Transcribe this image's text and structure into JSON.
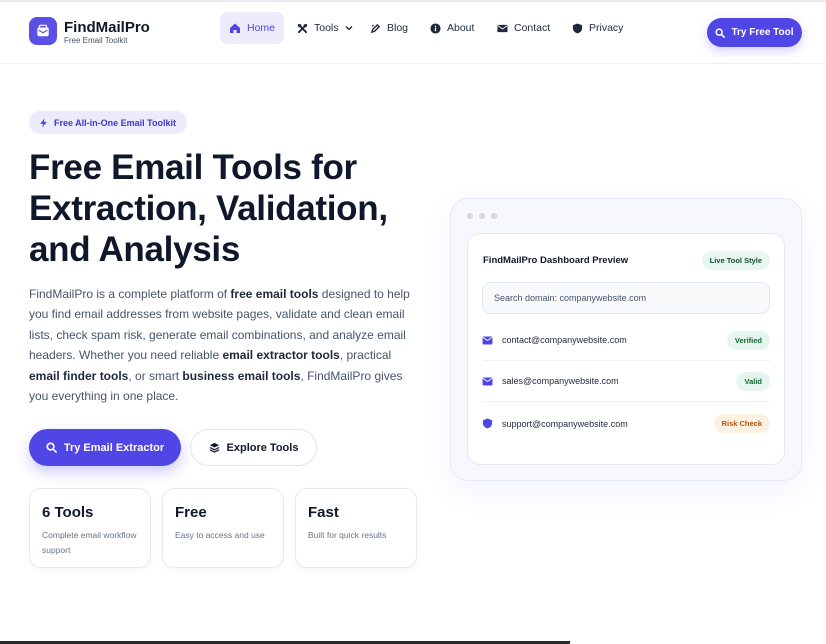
{
  "header": {
    "brand": "FindMailPro",
    "tagline": "Free Email Toolkit",
    "nav": [
      {
        "label": "Home",
        "icon": "home-icon"
      },
      {
        "label": "Tools",
        "icon": "tools-icon"
      },
      {
        "label": "Blog",
        "icon": "blog-icon"
      },
      {
        "label": "About",
        "icon": "info-icon"
      },
      {
        "label": "Contact",
        "icon": "envelope-icon"
      },
      {
        "label": "Privacy",
        "icon": "shield-icon"
      }
    ],
    "cta": "Try Free Tool"
  },
  "hero": {
    "badge": "Free All-in-One Email Toolkit",
    "title_lines": [
      "Free Email Tools for",
      "Extraction, Validation,",
      "and Analysis"
    ],
    "description": {
      "p1": "FindMailPro is a complete platform of ",
      "b1": "free email tools",
      "p2": " designed to help you find email addresses from website pages, validate and clean email lists, check spam risk, generate email combinations, and analyze email headers. Whether you need reliable ",
      "b2": "email extractor tools",
      "p3": ", practical ",
      "b3": "email finder tools",
      "p4": ", or smart ",
      "b4": "business email tools",
      "p5": ", FindMailPro gives you everything in one place."
    },
    "primary_button": "Try Email Extractor",
    "secondary_button": "Explore Tools"
  },
  "stats": [
    {
      "title": "6 Tools",
      "subtitle": "Complete email workflow support"
    },
    {
      "title": "Free",
      "subtitle": "Easy to access and use"
    },
    {
      "title": "Fast",
      "subtitle": "Built for quick results"
    }
  ],
  "preview": {
    "title": "FindMailPro Dashboard Preview",
    "tag": "Live Tool Style",
    "search_placeholder": "Search domain: companywebsite.com",
    "rows": [
      {
        "email": "contact@companywebsite.com",
        "status": "Verified",
        "icon": "envelope-icon"
      },
      {
        "email": "sales@companywebsite.com",
        "status": "Valid",
        "icon": "envelope-icon"
      },
      {
        "email": "support@companywebsite.com",
        "status": "Risk Check",
        "icon": "shield-icon"
      }
    ]
  },
  "colors": {
    "accent": "#5046e5",
    "accent_soft": "#ebebfa",
    "text_dark": "#0f172a",
    "text_muted": "#475569",
    "status_green": "#166534",
    "status_orange": "#b45309"
  }
}
